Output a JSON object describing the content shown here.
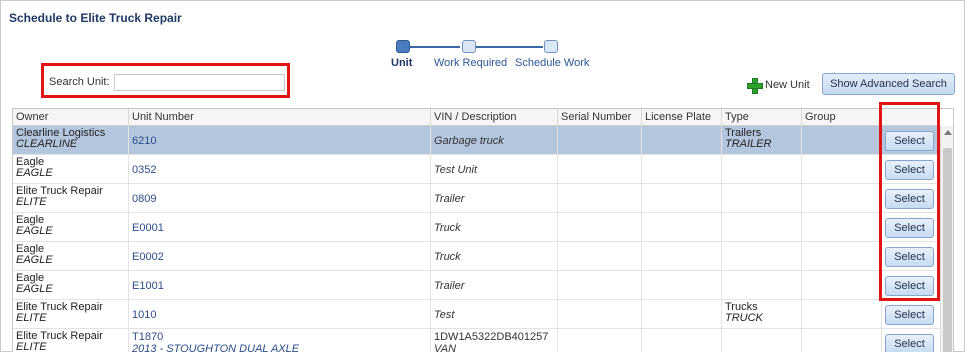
{
  "dialog": {
    "title": "Schedule to Elite Truck Repair"
  },
  "steps": [
    {
      "label": "Unit",
      "active": true
    },
    {
      "label": "Work Required",
      "active": false
    },
    {
      "label": "Schedule Work",
      "active": false
    }
  ],
  "search": {
    "label": "Search Unit:",
    "value": "",
    "placeholder": ""
  },
  "actions": {
    "new_unit": "New Unit",
    "show_advanced_search": "Show Advanced Search"
  },
  "grid": {
    "columns": [
      "Owner",
      "Unit Number",
      "VIN / Description",
      "Serial Number",
      "License Plate",
      "Type",
      "Group"
    ],
    "select_label": "Select",
    "rows": [
      {
        "owner": "Clearline Logistics",
        "owner_code": "CLEARLINE",
        "unit": "6210",
        "unit_desc": "",
        "vin": "",
        "description": "Garbage truck",
        "serial": "",
        "plate": "",
        "type": "Trailers",
        "type_code": "TRAILER",
        "group": "",
        "selected": true
      },
      {
        "owner": "Eagle",
        "owner_code": "EAGLE",
        "unit": "0352",
        "unit_desc": "",
        "vin": "",
        "description": "Test Unit",
        "serial": "",
        "plate": "",
        "type": "",
        "type_code": "",
        "group": ""
      },
      {
        "owner": "Elite Truck Repair",
        "owner_code": "ELITE",
        "unit": "0809",
        "unit_desc": "",
        "vin": "",
        "description": "Trailer",
        "serial": "",
        "plate": "",
        "type": "",
        "type_code": "",
        "group": ""
      },
      {
        "owner": "Eagle",
        "owner_code": "EAGLE",
        "unit": "E0001",
        "unit_desc": "",
        "vin": "",
        "description": "Truck",
        "serial": "",
        "plate": "",
        "type": "",
        "type_code": "",
        "group": ""
      },
      {
        "owner": "Eagle",
        "owner_code": "EAGLE",
        "unit": "E0002",
        "unit_desc": "",
        "vin": "",
        "description": "Truck",
        "serial": "",
        "plate": "",
        "type": "",
        "type_code": "",
        "group": ""
      },
      {
        "owner": "Eagle",
        "owner_code": "EAGLE",
        "unit": "E1001",
        "unit_desc": "",
        "vin": "",
        "description": "Trailer",
        "serial": "",
        "plate": "",
        "type": "",
        "type_code": "",
        "group": ""
      },
      {
        "owner": "Elite Truck Repair",
        "owner_code": "ELITE",
        "unit": "1010",
        "unit_desc": "",
        "vin": "",
        "description": "Test",
        "serial": "",
        "plate": "",
        "type": "Trucks",
        "type_code": "TRUCK",
        "group": ""
      },
      {
        "owner": "Elite Truck Repair",
        "owner_code": "ELITE",
        "unit": "T1870",
        "unit_desc": "2013 - STOUGHTON DUAL AXLE",
        "vin": "1DW1A5322DB401257",
        "description": "VAN",
        "serial": "",
        "plate": "",
        "type": "",
        "type_code": "",
        "group": ""
      }
    ]
  },
  "colors": {
    "accent": "#2b5797",
    "highlight": "#e01414",
    "selected_row": "#b4c6de",
    "plus": "#2ea02e"
  }
}
